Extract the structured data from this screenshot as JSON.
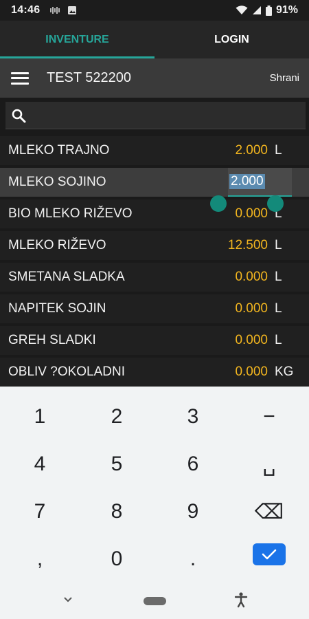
{
  "status_bar": {
    "time": "14:46",
    "battery": "91%"
  },
  "tabs": [
    {
      "label": "INVENTURE",
      "active": true
    },
    {
      "label": "LOGIN",
      "active": false
    }
  ],
  "toolbar": {
    "title": "TEST 522200",
    "save_label": "Shrani"
  },
  "items": [
    {
      "name": "MLEKO TRAJNO",
      "qty": "2.000",
      "unit": "L"
    },
    {
      "name": "MLEKO SOJINO",
      "qty": "2.000",
      "unit": "",
      "editing": true
    },
    {
      "name": "BIO MLEKO RIŽEVO",
      "qty": "0.000",
      "unit": "L"
    },
    {
      "name": "MLEKO RIŽEVO",
      "qty": "12.500",
      "unit": "L"
    },
    {
      "name": "SMETANA SLADKA",
      "qty": "0.000",
      "unit": "L"
    },
    {
      "name": "NAPITEK SOJIN",
      "qty": "0.000",
      "unit": "L"
    },
    {
      "name": "GREH SLADKI",
      "qty": "0.000",
      "unit": "L"
    },
    {
      "name": "OBLIV ?OKOLADNI",
      "qty": "0.000",
      "unit": "KG"
    }
  ],
  "keyboard": {
    "keys": [
      "1",
      "2",
      "3",
      "−",
      "4",
      "5",
      "6",
      "␣",
      "7",
      "8",
      "9",
      "⌫",
      ",",
      "0",
      ".",
      "✓"
    ]
  },
  "colors": {
    "accent": "#26a69a",
    "quantity": "#f3b61f",
    "enter_key": "#1a73e8"
  }
}
